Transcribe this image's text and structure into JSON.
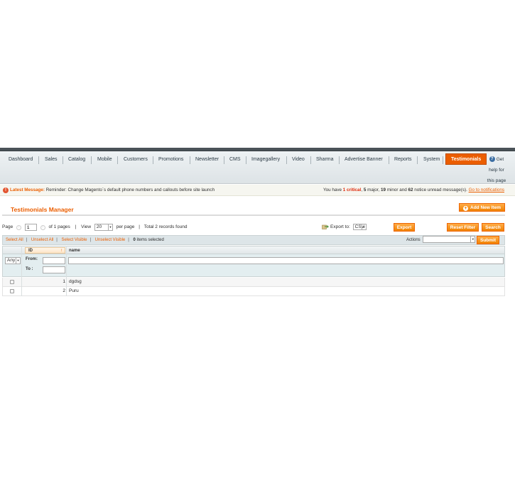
{
  "nav": {
    "items": [
      {
        "label": "Dashboard",
        "active": false
      },
      {
        "label": "Sales",
        "active": false
      },
      {
        "label": "Catalog",
        "active": false
      },
      {
        "label": "Mobile",
        "active": false
      },
      {
        "label": "Customers",
        "active": false
      },
      {
        "label": "Promotions",
        "active": false
      },
      {
        "label": "Newsletter",
        "active": false
      },
      {
        "label": "CMS",
        "active": false
      },
      {
        "label": "Imagegallery",
        "active": false
      },
      {
        "label": "Video",
        "active": false
      },
      {
        "label": "Sharma",
        "active": false
      },
      {
        "label": "Advertise Banner",
        "active": false
      },
      {
        "label": "Reports",
        "active": false
      },
      {
        "label": "System",
        "active": false
      },
      {
        "label": "Testimonials",
        "active": true
      }
    ],
    "help_line1": "Get",
    "help_line2": "help for",
    "help_line3": "this page",
    "help_icon": "help-icon"
  },
  "message": {
    "label": "Latest Message:",
    "text": "Reminder: Change Magento`s default phone numbers and callouts before site launch",
    "you_have": "You have",
    "critical_count": "1",
    "critical_label": "critical",
    "major_count": "5",
    "major_label": "major,",
    "minor_count": "19",
    "minor_label": "minor and",
    "notice_count": "62",
    "notice_label": "notice unread message(s).",
    "link": "Go to notifications"
  },
  "header": {
    "title": "Testimonials Manager",
    "add_button": "Add New Item"
  },
  "pager": {
    "page_label": "Page",
    "page_value": "1",
    "of_pages": "of 1 pages",
    "view_label": "View",
    "per_page_value": "20",
    "per_page_label": "per page",
    "total": "Total 2 records found"
  },
  "export": {
    "label": "Export to:",
    "format": "CSV",
    "button": "Export"
  },
  "filters": {
    "reset": "Reset Filter",
    "search": "Search"
  },
  "massaction": {
    "select_all": "Select All",
    "unselect_all": "Unselect All",
    "select_visible": "Select Visible",
    "unselect_visible": "Unselect Visible",
    "selected_count": "0",
    "selected_label": "items selected",
    "actions_label": "Actions",
    "submit": "Submit"
  },
  "grid": {
    "columns": [
      "ID",
      "name"
    ],
    "filter_any": "Any",
    "from_label": "From:",
    "to_label": "To :",
    "rows": [
      {
        "id": "1",
        "name": "dgdsg"
      },
      {
        "id": "2",
        "name": "Puru"
      }
    ]
  },
  "colors": {
    "accent": "#eb5e00",
    "critical": "#df280a",
    "nav_bar": "#4a5258"
  }
}
